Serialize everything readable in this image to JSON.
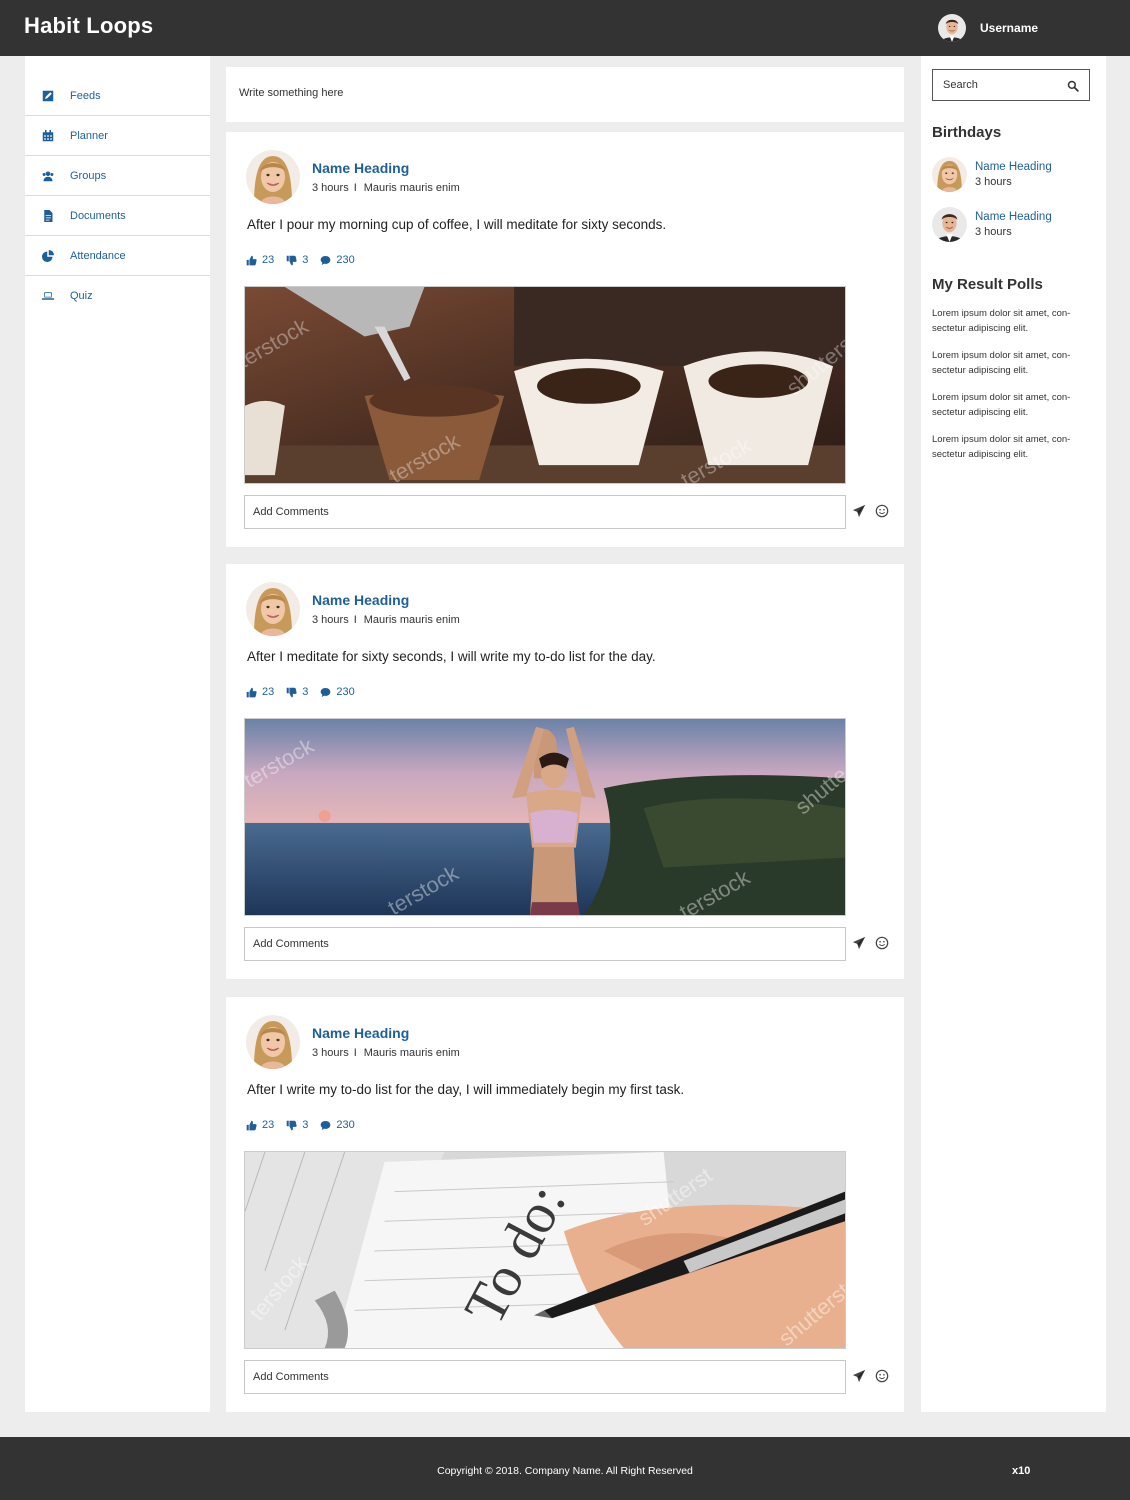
{
  "header": {
    "brand": "Habit Loops",
    "username": "Username"
  },
  "sidebar": {
    "items": [
      {
        "label": "Feeds",
        "icon": "edit-icon"
      },
      {
        "label": "Planner",
        "icon": "calendar-icon"
      },
      {
        "label": "Groups",
        "icon": "users-icon"
      },
      {
        "label": "Documents",
        "icon": "document-icon"
      },
      {
        "label": "Attendance",
        "icon": "pie-chart-icon"
      },
      {
        "label": "Quiz",
        "icon": "laptop-icon"
      }
    ]
  },
  "composer": {
    "placeholder": "Write something here"
  },
  "posts": [
    {
      "name": "Name Heading",
      "time": "3 hours",
      "separator": "I",
      "subtitle": "Mauris mauris enim",
      "text": "After I pour my morning cup of coffee, I will meditate for sixty seconds.",
      "likes": "23",
      "dislikes": "3",
      "comments": "230",
      "image": "coffee-pour-over-photo",
      "comment_placeholder": "Add Comments"
    },
    {
      "name": "Name Heading",
      "time": "3 hours",
      "separator": "I",
      "subtitle": "Mauris mauris enim",
      "text": "After I meditate for sixty seconds, I will write my to-do list for the day.",
      "likes": "23",
      "dislikes": "3",
      "comments": "230",
      "image": "yoga-by-sea-photo",
      "comment_placeholder": "Add Comments"
    },
    {
      "name": "Name Heading",
      "time": "3 hours",
      "separator": "I",
      "subtitle": "Mauris mauris enim",
      "text": "After I write my to-do list for the day, I will immediately begin my first task.",
      "likes": "23",
      "dislikes": "3",
      "comments": "230",
      "image": "to-do-notebook-photo",
      "comment_placeholder": "Add Comments"
    }
  ],
  "rightbar": {
    "search_placeholder": "Search",
    "birthdays_title": "Birthdays",
    "birthdays": [
      {
        "name": "Name Heading",
        "time": "3 hours"
      },
      {
        "name": "Name Heading",
        "time": "3 hours"
      }
    ],
    "polls_title": "My Result Polls",
    "polls": [
      "Lorem ipsum dolor sit amet, con-sectetur adipiscing elit.",
      "Lorem ipsum dolor sit amet, con-sectetur adipiscing elit.",
      "Lorem ipsum dolor sit amet, con-sectetur adipiscing elit.",
      "Lorem ipsum dolor sit amet, con-sectetur adipiscing elit."
    ]
  },
  "footer": {
    "copyright": "Copyright © 2018. Company Name.   All Right Reserved",
    "mark": "x10"
  },
  "colors": {
    "header_bg": "#333333",
    "accent": "#1f5f99",
    "page_bg": "#ededed"
  }
}
